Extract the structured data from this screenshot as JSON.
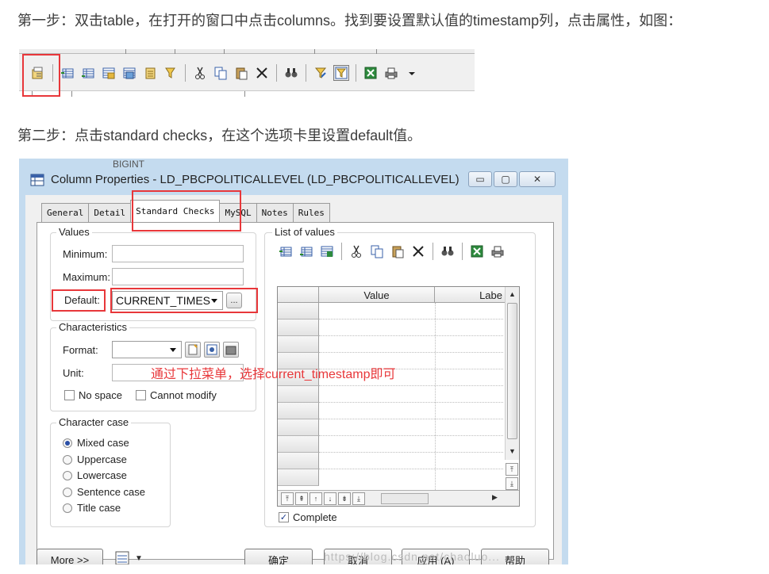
{
  "steps": {
    "step1": "第一步：双击table，在打开的窗口中点击columns。找到要设置默认值的timestamp列，点击属性，如图：",
    "step2": "第二步：点击standard checks，在这个选项卡里设置default值。"
  },
  "toolbar": {
    "icons": [
      "properties-icon",
      "insert-row-icon",
      "add-row-icon",
      "add-rows-icon",
      "copy-rows-icon",
      "paste-rows-icon",
      "filter-icon",
      "cut-icon",
      "copy-icon",
      "paste-icon",
      "delete-icon",
      "find-icon",
      "customize-icon",
      "customize-columns-icon",
      "excel-icon",
      "print-icon",
      "dropdown-icon"
    ]
  },
  "background_text": "BIGINT",
  "dialog": {
    "title": "Column Properties - LD_PBCPOLITICALLEVEL (LD_PBCPOLITICALLEVEL)",
    "tabs": [
      "General",
      "Detail",
      "Standard Checks",
      "MySQL",
      "Notes",
      "Rules"
    ],
    "active_tab": "Standard Checks",
    "values_group": {
      "label": "Values",
      "minimum_label": "Minimum:",
      "minimum_value": "",
      "maximum_label": "Maximum:",
      "maximum_value": "",
      "default_label": "Default:",
      "default_value": "CURRENT_TIMES",
      "ellipsis": "..."
    },
    "characteristics": {
      "label": "Characteristics",
      "format_label": "Format:",
      "unit_label": "Unit:",
      "no_space": "No space",
      "cannot_modify": "Cannot modify"
    },
    "character_case": {
      "label": "Character case",
      "options": [
        "Mixed case",
        "Uppercase",
        "Lowercase",
        "Sentence case",
        "Title case"
      ],
      "selected": "Mixed case"
    },
    "list_of_values": {
      "label": "List of values",
      "col_value": "Value",
      "col_label": "Labe",
      "complete_label": "Complete",
      "complete_checked": true
    },
    "annotation": "通过下拉菜单，选择current_timestamp即可",
    "buttons": {
      "more": "More >>",
      "ok": "确定",
      "cancel": "取消",
      "apply": "应用 (A)",
      "help": "帮助"
    }
  },
  "watermark": "https://blog.csdn.net/chaoluo..."
}
